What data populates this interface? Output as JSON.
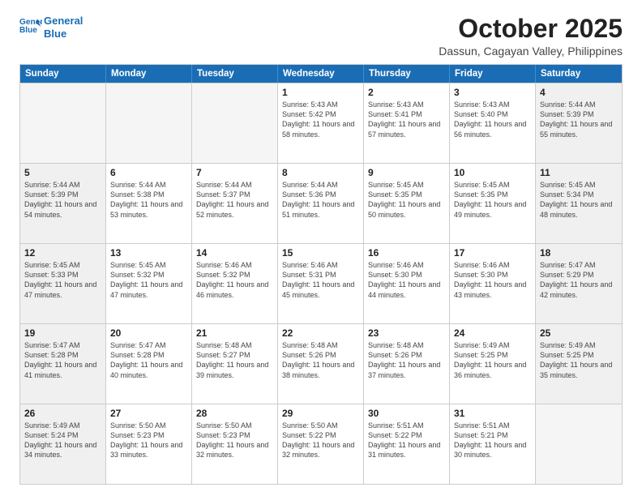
{
  "logo": {
    "line1": "General",
    "line2": "Blue"
  },
  "header": {
    "month": "October 2025",
    "location": "Dassun, Cagayan Valley, Philippines"
  },
  "weekdays": [
    "Sunday",
    "Monday",
    "Tuesday",
    "Wednesday",
    "Thursday",
    "Friday",
    "Saturday"
  ],
  "rows": [
    [
      {
        "day": "",
        "empty": true
      },
      {
        "day": "",
        "empty": true
      },
      {
        "day": "",
        "empty": true
      },
      {
        "day": "1",
        "sunrise": "5:43 AM",
        "sunset": "5:42 PM",
        "daylight": "11 hours and 58 minutes."
      },
      {
        "day": "2",
        "sunrise": "5:43 AM",
        "sunset": "5:41 PM",
        "daylight": "11 hours and 57 minutes."
      },
      {
        "day": "3",
        "sunrise": "5:43 AM",
        "sunset": "5:40 PM",
        "daylight": "11 hours and 56 minutes."
      },
      {
        "day": "4",
        "sunrise": "5:44 AM",
        "sunset": "5:39 PM",
        "daylight": "11 hours and 55 minutes.",
        "shaded": true
      }
    ],
    [
      {
        "day": "5",
        "sunrise": "5:44 AM",
        "sunset": "5:39 PM",
        "daylight": "11 hours and 54 minutes.",
        "shaded": true
      },
      {
        "day": "6",
        "sunrise": "5:44 AM",
        "sunset": "5:38 PM",
        "daylight": "11 hours and 53 minutes."
      },
      {
        "day": "7",
        "sunrise": "5:44 AM",
        "sunset": "5:37 PM",
        "daylight": "11 hours and 52 minutes."
      },
      {
        "day": "8",
        "sunrise": "5:44 AM",
        "sunset": "5:36 PM",
        "daylight": "11 hours and 51 minutes."
      },
      {
        "day": "9",
        "sunrise": "5:45 AM",
        "sunset": "5:35 PM",
        "daylight": "11 hours and 50 minutes."
      },
      {
        "day": "10",
        "sunrise": "5:45 AM",
        "sunset": "5:35 PM",
        "daylight": "11 hours and 49 minutes."
      },
      {
        "day": "11",
        "sunrise": "5:45 AM",
        "sunset": "5:34 PM",
        "daylight": "11 hours and 48 minutes.",
        "shaded": true
      }
    ],
    [
      {
        "day": "12",
        "sunrise": "5:45 AM",
        "sunset": "5:33 PM",
        "daylight": "11 hours and 47 minutes.",
        "shaded": true
      },
      {
        "day": "13",
        "sunrise": "5:45 AM",
        "sunset": "5:32 PM",
        "daylight": "11 hours and 47 minutes."
      },
      {
        "day": "14",
        "sunrise": "5:46 AM",
        "sunset": "5:32 PM",
        "daylight": "11 hours and 46 minutes."
      },
      {
        "day": "15",
        "sunrise": "5:46 AM",
        "sunset": "5:31 PM",
        "daylight": "11 hours and 45 minutes."
      },
      {
        "day": "16",
        "sunrise": "5:46 AM",
        "sunset": "5:30 PM",
        "daylight": "11 hours and 44 minutes."
      },
      {
        "day": "17",
        "sunrise": "5:46 AM",
        "sunset": "5:30 PM",
        "daylight": "11 hours and 43 minutes."
      },
      {
        "day": "18",
        "sunrise": "5:47 AM",
        "sunset": "5:29 PM",
        "daylight": "11 hours and 42 minutes.",
        "shaded": true
      }
    ],
    [
      {
        "day": "19",
        "sunrise": "5:47 AM",
        "sunset": "5:28 PM",
        "daylight": "11 hours and 41 minutes.",
        "shaded": true
      },
      {
        "day": "20",
        "sunrise": "5:47 AM",
        "sunset": "5:28 PM",
        "daylight": "11 hours and 40 minutes."
      },
      {
        "day": "21",
        "sunrise": "5:48 AM",
        "sunset": "5:27 PM",
        "daylight": "11 hours and 39 minutes."
      },
      {
        "day": "22",
        "sunrise": "5:48 AM",
        "sunset": "5:26 PM",
        "daylight": "11 hours and 38 minutes."
      },
      {
        "day": "23",
        "sunrise": "5:48 AM",
        "sunset": "5:26 PM",
        "daylight": "11 hours and 37 minutes."
      },
      {
        "day": "24",
        "sunrise": "5:49 AM",
        "sunset": "5:25 PM",
        "daylight": "11 hours and 36 minutes."
      },
      {
        "day": "25",
        "sunrise": "5:49 AM",
        "sunset": "5:25 PM",
        "daylight": "11 hours and 35 minutes.",
        "shaded": true
      }
    ],
    [
      {
        "day": "26",
        "sunrise": "5:49 AM",
        "sunset": "5:24 PM",
        "daylight": "11 hours and 34 minutes.",
        "shaded": true
      },
      {
        "day": "27",
        "sunrise": "5:50 AM",
        "sunset": "5:23 PM",
        "daylight": "11 hours and 33 minutes."
      },
      {
        "day": "28",
        "sunrise": "5:50 AM",
        "sunset": "5:23 PM",
        "daylight": "11 hours and 32 minutes."
      },
      {
        "day": "29",
        "sunrise": "5:50 AM",
        "sunset": "5:22 PM",
        "daylight": "11 hours and 32 minutes."
      },
      {
        "day": "30",
        "sunrise": "5:51 AM",
        "sunset": "5:22 PM",
        "daylight": "11 hours and 31 minutes."
      },
      {
        "day": "31",
        "sunrise": "5:51 AM",
        "sunset": "5:21 PM",
        "daylight": "11 hours and 30 minutes."
      },
      {
        "day": "",
        "empty": true,
        "shaded": true
      }
    ]
  ]
}
